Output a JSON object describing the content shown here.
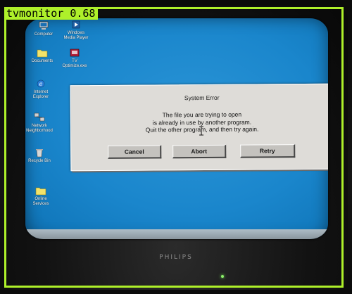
{
  "desktop": {
    "icons": [
      {
        "label": "Computer",
        "icon": "computer-icon"
      },
      {
        "label": "Windows Media Player",
        "icon": "media-player-icon"
      },
      {
        "label": "Documents",
        "icon": "folder-icon"
      },
      {
        "label": "TV Optimize.exe",
        "icon": "tv-app-icon"
      },
      {
        "label": "Internet Explorer",
        "icon": "browser-icon"
      },
      {
        "label": "Network Neighborhood",
        "icon": "network-icon"
      },
      {
        "label": "Recycle Bin",
        "icon": "recycle-bin-icon"
      },
      {
        "label": "Online Services",
        "icon": "folder-icon"
      }
    ]
  },
  "dialog": {
    "title": "System Error",
    "message_lines": [
      "The file you are trying to open",
      "is already in use by another program.",
      "Quit the other program, and then try again."
    ],
    "buttons": {
      "cancel": "Cancel",
      "abort": "Abort",
      "retry": "Retry"
    }
  },
  "tv": {
    "brand": "PHILIPS"
  },
  "detection": {
    "label": "tvmonitor",
    "score": "0.68",
    "color": "#aef02a"
  }
}
